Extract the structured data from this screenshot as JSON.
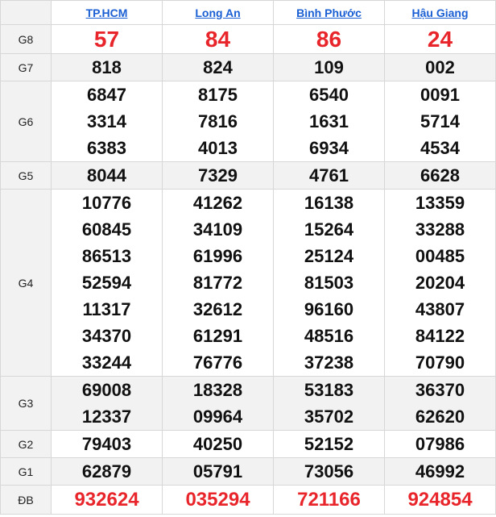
{
  "provinces": [
    "TP.HCM",
    "Long An",
    "Bình Phước",
    "Hậu Giang"
  ],
  "prizes": [
    {
      "label": "G8",
      "values": [
        [
          "57"
        ],
        [
          "84"
        ],
        [
          "86"
        ],
        [
          "24"
        ]
      ]
    },
    {
      "label": "G7",
      "values": [
        [
          "818"
        ],
        [
          "824"
        ],
        [
          "109"
        ],
        [
          "002"
        ]
      ]
    },
    {
      "label": "G6",
      "values": [
        [
          "6847",
          "3314",
          "6383"
        ],
        [
          "8175",
          "7816",
          "4013"
        ],
        [
          "6540",
          "1631",
          "6934"
        ],
        [
          "0091",
          "5714",
          "4534"
        ]
      ]
    },
    {
      "label": "G5",
      "values": [
        [
          "8044"
        ],
        [
          "7329"
        ],
        [
          "4761"
        ],
        [
          "6628"
        ]
      ]
    },
    {
      "label": "G4",
      "values": [
        [
          "10776",
          "60845",
          "86513",
          "52594",
          "11317",
          "34370",
          "33244"
        ],
        [
          "41262",
          "34109",
          "61996",
          "81772",
          "32612",
          "61291",
          "76776"
        ],
        [
          "16138",
          "15264",
          "25124",
          "81503",
          "96160",
          "48516",
          "37238"
        ],
        [
          "13359",
          "33288",
          "00485",
          "20204",
          "43807",
          "84122",
          "70790"
        ]
      ]
    },
    {
      "label": "G3",
      "values": [
        [
          "69008",
          "12337"
        ],
        [
          "18328",
          "09964"
        ],
        [
          "53183",
          "35702"
        ],
        [
          "36370",
          "62620"
        ]
      ]
    },
    {
      "label": "G2",
      "values": [
        [
          "79403"
        ],
        [
          "40250"
        ],
        [
          "52152"
        ],
        [
          "07986"
        ]
      ]
    },
    {
      "label": "G1",
      "values": [
        [
          "62879"
        ],
        [
          "05791"
        ],
        [
          "73056"
        ],
        [
          "46992"
        ]
      ]
    },
    {
      "label": "ĐB",
      "values": [
        [
          "932624"
        ],
        [
          "035294"
        ],
        [
          "721166"
        ],
        [
          "924854"
        ]
      ]
    }
  ],
  "colors": {
    "highlight": "#e8252a",
    "link": "#1a5fd3",
    "alt_row": "#f2f2f2"
  }
}
